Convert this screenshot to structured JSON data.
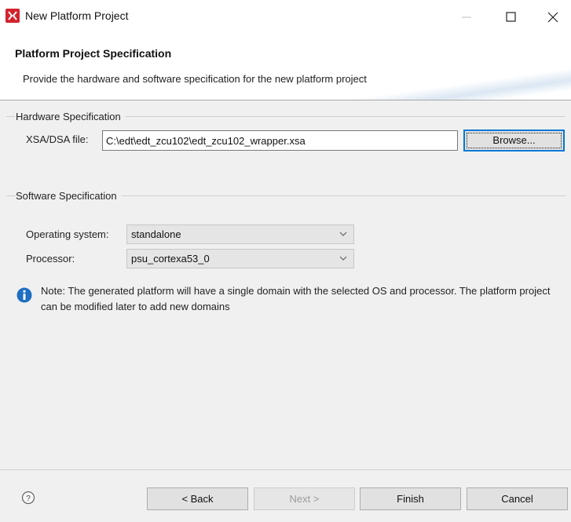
{
  "window": {
    "title": "New Platform Project",
    "app_icon": "xilinx-logo-icon",
    "controls": [
      "minimize-icon",
      "maximize-icon",
      "close-icon"
    ]
  },
  "banner": {
    "title": "Platform Project Specification",
    "description": "Provide the hardware and software specification for the new platform project"
  },
  "hardware": {
    "group_label": "Hardware Specification",
    "file_label": "XSA/DSA file:",
    "file_value": "C:\\edt\\edt_zcu102\\edt_zcu102_wrapper.xsa",
    "browse_label": "Browse..."
  },
  "software": {
    "group_label": "Software Specification",
    "os_label": "Operating system:",
    "os_value": "standalone",
    "processor_label": "Processor:",
    "processor_value": "psu_cortexa53_0"
  },
  "note": {
    "icon": "info-icon",
    "text": "Note: The generated platform will have a single domain with the selected OS and processor. The platform project can be modified later to add new domains"
  },
  "footer": {
    "help_icon": "help-icon",
    "back_label": "< Back",
    "next_label": "Next >",
    "finish_label": "Finish",
    "cancel_label": "Cancel"
  },
  "colors": {
    "app_icon": "#d3232d",
    "info_icon": "#1e6fc2",
    "default_button_border": "#0078d7",
    "panel_background": "#f0f0f0"
  }
}
